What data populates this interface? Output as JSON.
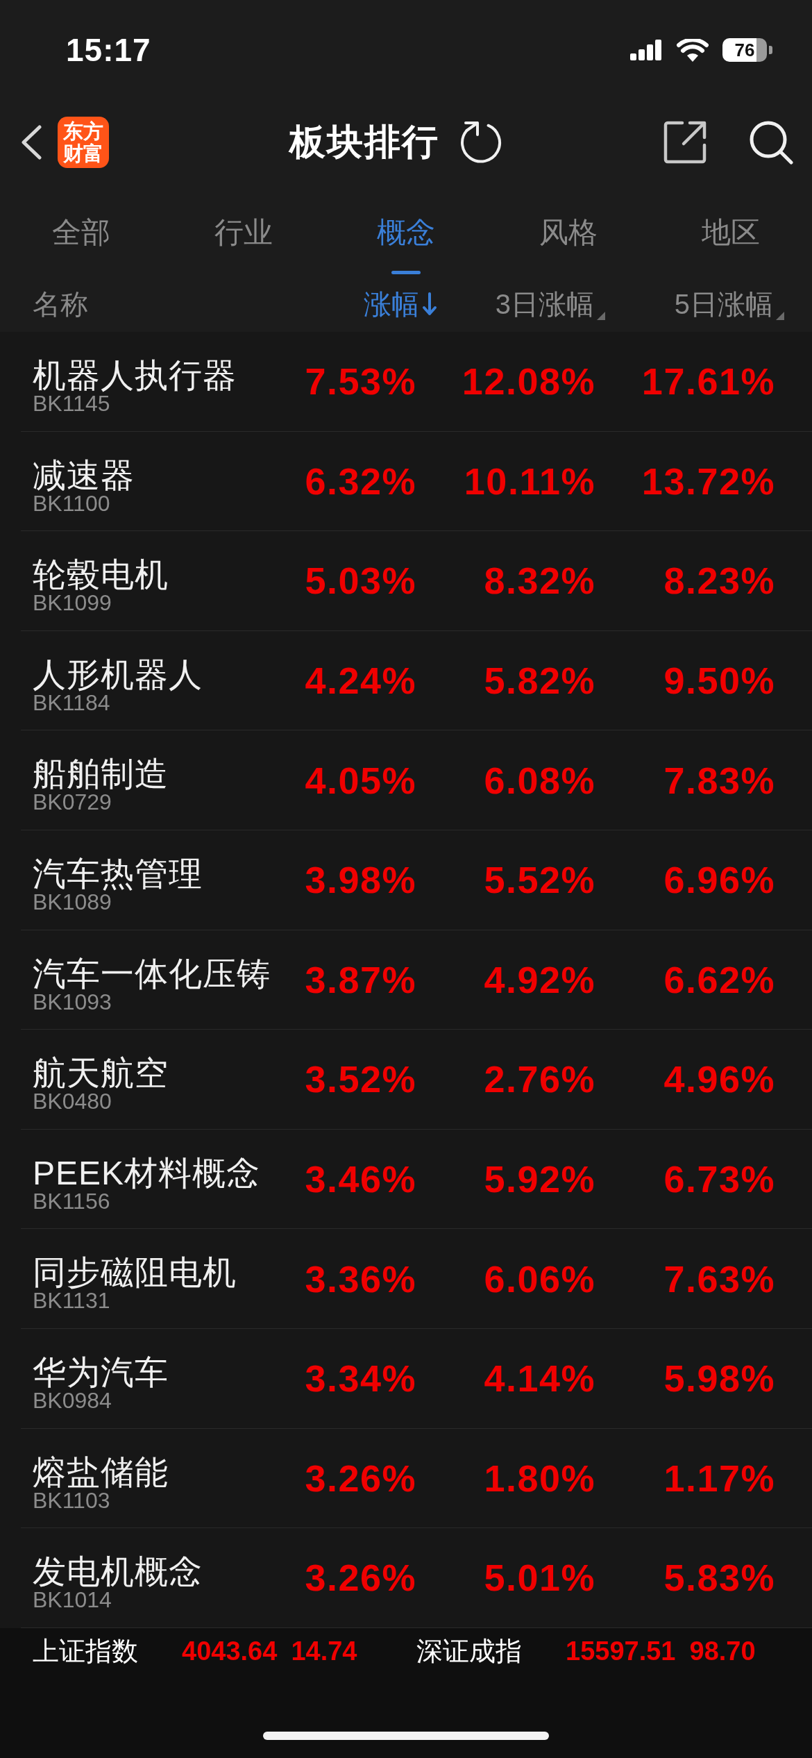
{
  "status_bar": {
    "time": "15:17",
    "battery": "76"
  },
  "nav": {
    "logo_lines": [
      "东方",
      "财富"
    ],
    "title": "板块排行"
  },
  "tabs": [
    {
      "label": "全部",
      "selected": false
    },
    {
      "label": "行业",
      "selected": false
    },
    {
      "label": "概念",
      "selected": true
    },
    {
      "label": "风格",
      "selected": false
    },
    {
      "label": "地区",
      "selected": false
    }
  ],
  "table": {
    "name_header": "名称",
    "columns": [
      {
        "label": "涨幅",
        "selected": true
      },
      {
        "label": "3日涨幅",
        "selected": false
      },
      {
        "label": "5日涨幅",
        "selected": false
      }
    ],
    "rows": [
      {
        "name": "机器人执行器",
        "code": "BK1145",
        "values": [
          "7.53%",
          "12.08%",
          "17.61%"
        ]
      },
      {
        "name": "减速器",
        "code": "BK1100",
        "values": [
          "6.32%",
          "10.11%",
          "13.72%"
        ]
      },
      {
        "name": "轮毂电机",
        "code": "BK1099",
        "values": [
          "5.03%",
          "8.32%",
          "8.23%"
        ]
      },
      {
        "name": "人形机器人",
        "code": "BK1184",
        "values": [
          "4.24%",
          "5.82%",
          "9.50%"
        ]
      },
      {
        "name": "船舶制造",
        "code": "BK0729",
        "values": [
          "4.05%",
          "6.08%",
          "7.83%"
        ]
      },
      {
        "name": "汽车热管理",
        "code": "BK1089",
        "values": [
          "3.98%",
          "5.52%",
          "6.96%"
        ]
      },
      {
        "name": "汽车一体化压铸",
        "code": "BK1093",
        "values": [
          "3.87%",
          "4.92%",
          "6.62%"
        ]
      },
      {
        "name": "航天航空",
        "code": "BK0480",
        "values": [
          "3.52%",
          "2.76%",
          "4.96%"
        ]
      },
      {
        "name": "PEEK材料概念",
        "code": "BK1156",
        "values": [
          "3.46%",
          "5.92%",
          "6.73%"
        ]
      },
      {
        "name": "同步磁阻电机",
        "code": "BK1131",
        "values": [
          "3.36%",
          "6.06%",
          "7.63%"
        ]
      },
      {
        "name": "华为汽车",
        "code": "BK0984",
        "values": [
          "3.34%",
          "4.14%",
          "5.98%"
        ]
      },
      {
        "name": "熔盐储能",
        "code": "BK1103",
        "values": [
          "3.26%",
          "1.80%",
          "1.17%"
        ]
      },
      {
        "name": "发电机概念",
        "code": "BK1014",
        "values": [
          "3.26%",
          "5.01%",
          "5.83%"
        ]
      }
    ]
  },
  "index_bar": [
    {
      "name": "上证指数",
      "value": "4043.64",
      "change": "14.74"
    },
    {
      "name": "深证成指",
      "value": "15597.51",
      "change": "98.70"
    }
  ]
}
